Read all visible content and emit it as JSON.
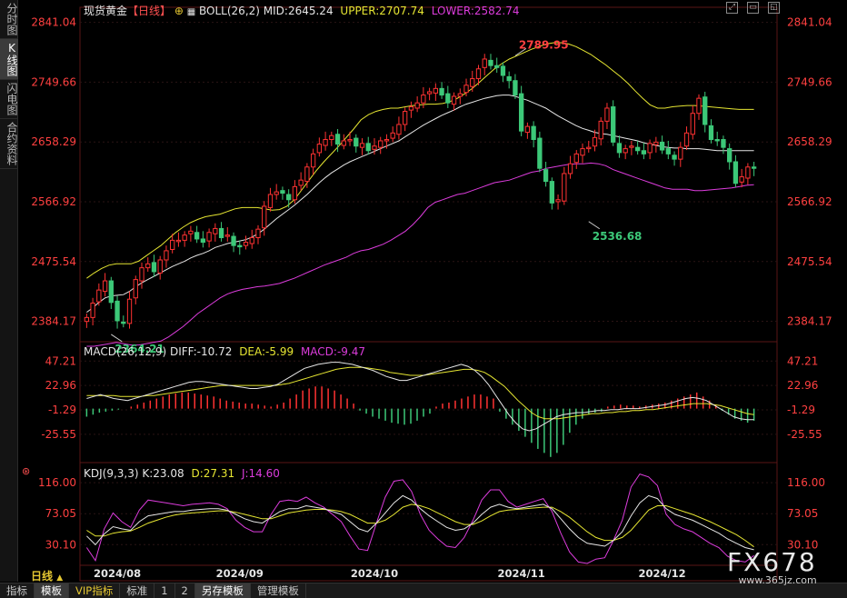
{
  "side_tabs": [
    {
      "label": "分时图",
      "active": false
    },
    {
      "label": "K线图",
      "active": true
    },
    {
      "label": "闪电图",
      "active": false
    },
    {
      "label": "合约资料",
      "active": false
    }
  ],
  "main_header": {
    "symbol": "现货黄金",
    "period_tag": "【日线】",
    "boll_label": "BOLL(26,2)",
    "mid": "MID:2645.24",
    "upper": "UPPER:2707.74",
    "lower": "LOWER:2582.74"
  },
  "macd_header": {
    "label": "MACD(26,12,9)",
    "diff": "DIFF:-10.72",
    "dea": "DEA:-5.99",
    "macd": "MACD:-9.47"
  },
  "kdj_header": {
    "label": "KDJ(9,3,3)",
    "k": "K:23.08",
    "d": "D:27.31",
    "j": "J:14.60"
  },
  "period_button": "日线",
  "bottom_tabs": [
    {
      "label": "指标",
      "active": false
    },
    {
      "label": "模板",
      "active": true
    },
    {
      "label": "VIP指标",
      "active": false
    },
    {
      "label": "标准",
      "active": false
    },
    {
      "label": "1",
      "active": false
    },
    {
      "label": "2",
      "active": false
    },
    {
      "label": "另存模板",
      "active": true
    },
    {
      "label": "管理模板",
      "active": false
    }
  ],
  "watermark": {
    "brand": "FX678",
    "url": "www.365jz.com"
  },
  "colors": {
    "up": "#ff3232",
    "down": "#3cc878",
    "mid": "#e6e6e6",
    "upper": "#e6e632",
    "lower": "#dc3cdc",
    "price_label": "#ff4040",
    "grid": "#2e1a1a"
  },
  "chart_data": [
    {
      "type": "candlestick",
      "title": "现货黄金 日线",
      "y_ticks": [
        2841.04,
        2749.66,
        2658.29,
        2566.92,
        2475.54,
        2384.17
      ],
      "ylim": [
        2353,
        2853
      ],
      "x_labels": [
        "2024/08",
        "2024/09",
        "2024/10",
        "2024/11",
        "2024/12"
      ],
      "x_label_index": [
        5,
        25,
        47,
        71,
        94
      ],
      "annotations": [
        {
          "text": "2789.95",
          "index": 70,
          "value": 2789.95,
          "color": "#ff4040"
        },
        {
          "text": "2536.68",
          "index": 82,
          "value": 2536.68,
          "color": "#3cc878"
        },
        {
          "text": "2364.21",
          "index": 4,
          "value": 2364.21,
          "color": "#3cc878"
        }
      ],
      "closes": [
        2390,
        2412,
        2432,
        2446,
        2413,
        2385,
        2381,
        2418,
        2448,
        2466,
        2472,
        2460,
        2478,
        2492,
        2508,
        2508,
        2516,
        2522,
        2510,
        2505,
        2520,
        2526,
        2512,
        2516,
        2500,
        2498,
        2505,
        2512,
        2525,
        2560,
        2578,
        2582,
        2580,
        2570,
        2590,
        2600,
        2620,
        2640,
        2655,
        2662,
        2668,
        2655,
        2660,
        2662,
        2652,
        2656,
        2645,
        2652,
        2660,
        2662,
        2672,
        2685,
        2705,
        2712,
        2718,
        2730,
        2735,
        2740,
        2730,
        2718,
        2728,
        2732,
        2745,
        2755,
        2770,
        2785,
        2775,
        2772,
        2760,
        2752,
        2730,
        2675,
        2682,
        2662,
        2618,
        2598,
        2565,
        2570,
        2610,
        2625,
        2640,
        2648,
        2650,
        2665,
        2690,
        2710,
        2658,
        2642,
        2648,
        2652,
        2645,
        2640,
        2656,
        2658,
        2646,
        2640,
        2632,
        2650,
        2672,
        2702,
        2725,
        2685,
        2662,
        2660,
        2650,
        2628,
        2595,
        2605,
        2620,
        2618
      ],
      "mid": [
        2398,
        2405,
        2413,
        2420,
        2423,
        2424,
        2425,
        2430,
        2437,
        2443,
        2448,
        2453,
        2458,
        2463,
        2468,
        2472,
        2476,
        2481,
        2485,
        2488,
        2492,
        2497,
        2500,
        2503,
        2505,
        2507,
        2509,
        2513,
        2518,
        2525,
        2533,
        2541,
        2548,
        2555,
        2562,
        2570,
        2578,
        2587,
        2596,
        2604,
        2611,
        2617,
        2623,
        2628,
        2632,
        2636,
        2640,
        2644,
        2648,
        2652,
        2656,
        2660,
        2666,
        2672,
        2678,
        2684,
        2689,
        2694,
        2699,
        2703,
        2707,
        2712,
        2716,
        2719,
        2722,
        2725,
        2727,
        2729,
        2730,
        2730,
        2728,
        2725,
        2722,
        2718,
        2714,
        2710,
        2704,
        2698,
        2693,
        2688,
        2683,
        2679,
        2676,
        2673,
        2671,
        2670,
        2668,
        2666,
        2664,
        2662,
        2660,
        2657,
        2655,
        2653,
        2651,
        2650,
        2649,
        2649,
        2648,
        2648,
        2648,
        2647,
        2646,
        2645,
        2645,
        2645,
        2645,
        2645,
        2645,
        2645
      ],
      "upper": [
        2450,
        2458,
        2465,
        2470,
        2472,
        2472,
        2472,
        2476,
        2484,
        2492,
        2500,
        2510,
        2520,
        2528,
        2535,
        2540,
        2544,
        2546,
        2548,
        2552,
        2556,
        2558,
        2558,
        2558,
        2556,
        2554,
        2555,
        2560,
        2570,
        2585,
        2600,
        2615,
        2628,
        2640,
        2652,
        2665,
        2678,
        2692,
        2700,
        2705,
        2708,
        2710,
        2710,
        2712,
        2714,
        2715,
        2716,
        2716,
        2717,
        2720,
        2725,
        2732,
        2740,
        2750,
        2760,
        2770,
        2778,
        2785,
        2790,
        2795,
        2800,
        2804,
        2808,
        2810,
        2810,
        2808,
        2804,
        2798,
        2792,
        2784,
        2776,
        2767,
        2758,
        2748,
        2736,
        2725,
        2715,
        2710,
        2710,
        2712,
        2713,
        2714,
        2714,
        2713,
        2712,
        2711,
        2710,
        2709,
        2708,
        2708,
        2708
      ],
      "lower": [
        2346,
        2346,
        2348,
        2350,
        2352,
        2350,
        2348,
        2348,
        2350,
        2352,
        2354,
        2360,
        2368,
        2376,
        2386,
        2396,
        2404,
        2412,
        2420,
        2426,
        2430,
        2433,
        2435,
        2437,
        2438,
        2440,
        2442,
        2446,
        2450,
        2455,
        2460,
        2465,
        2470,
        2474,
        2478,
        2482,
        2488,
        2492,
        2494,
        2498,
        2502,
        2508,
        2515,
        2522,
        2532,
        2544,
        2558,
        2566,
        2570,
        2574,
        2578,
        2580,
        2584,
        2588,
        2592,
        2596,
        2598,
        2600,
        2604,
        2608,
        2612,
        2614,
        2618,
        2620,
        2622,
        2624,
        2625,
        2625,
        2626,
        2625,
        2622,
        2616,
        2612,
        2608,
        2604,
        2600,
        2596,
        2592,
        2588,
        2586,
        2586,
        2586,
        2584,
        2584,
        2585,
        2586,
        2587,
        2588,
        2590,
        2592,
        2593
      ]
    },
    {
      "type": "bar",
      "title": "MACD(26,12,9)",
      "y_ticks": [
        47.21,
        22.96,
        -1.29,
        -25.55
      ],
      "ylim": [
        -50,
        52
      ],
      "histogram": [
        -8,
        -6,
        -4,
        -3,
        -2,
        -1,
        0,
        2,
        4,
        6,
        8,
        10,
        12,
        14,
        15,
        16,
        16,
        15,
        14,
        13,
        12,
        10,
        8,
        7,
        6,
        5,
        5,
        4,
        3,
        2,
        4,
        6,
        10,
        14,
        18,
        20,
        22,
        22,
        20,
        18,
        14,
        10,
        5,
        -2,
        -5,
        -8,
        -10,
        -12,
        -14,
        -15,
        -16,
        -15,
        -12,
        -8,
        -5,
        2,
        5,
        6,
        8,
        10,
        12,
        14,
        14,
        12,
        10,
        -3,
        -10,
        -16,
        -22,
        -28,
        -34,
        -40,
        -44,
        -48,
        -44,
        -36,
        -24,
        -16,
        -10,
        -6,
        -4,
        -3,
        2,
        3,
        4,
        3,
        3,
        2,
        3,
        4,
        5,
        6,
        8,
        10,
        12,
        14,
        16,
        12,
        8,
        4,
        -2,
        -6,
        -10,
        -12,
        -14,
        -12
      ],
      "diff": [
        10,
        12,
        14,
        12,
        10,
        9,
        8,
        10,
        12,
        14,
        16,
        18,
        20,
        22,
        24,
        26,
        27,
        27,
        26,
        25,
        24,
        23,
        22,
        21,
        20,
        20,
        21,
        22,
        24,
        28,
        32,
        36,
        40,
        42,
        44,
        45,
        46,
        46,
        45,
        44,
        42,
        40,
        38,
        35,
        32,
        30,
        28,
        28,
        30,
        32,
        34,
        36,
        38,
        40,
        42,
        44,
        42,
        38,
        32,
        24,
        14,
        4,
        -6,
        -14,
        -20,
        -22,
        -20,
        -16,
        -12,
        -8,
        -6,
        -5,
        -4,
        -4,
        -3,
        -2,
        -2,
        -1,
        -1,
        0,
        0,
        0,
        1,
        2,
        3,
        4,
        6,
        8,
        10,
        11,
        10,
        8,
        4,
        0,
        -4,
        -8,
        -10,
        -11,
        -11
      ],
      "dea": [
        13,
        13,
        13,
        13,
        13,
        12,
        12,
        12,
        12,
        13,
        13,
        14,
        15,
        16,
        17,
        18,
        19,
        20,
        21,
        22,
        23,
        23,
        23,
        23,
        23,
        23,
        23,
        23,
        23,
        24,
        25,
        27,
        29,
        31,
        33,
        35,
        37,
        39,
        40,
        41,
        41,
        41,
        40,
        39,
        38,
        36,
        35,
        34,
        33,
        33,
        33,
        34,
        35,
        36,
        37,
        38,
        39,
        39,
        38,
        36,
        32,
        27,
        22,
        15,
        8,
        2,
        -4,
        -8,
        -10,
        -10,
        -10,
        -9,
        -8,
        -7,
        -6,
        -5,
        -5,
        -4,
        -4,
        -3,
        -3,
        -2,
        -2,
        -1,
        -1,
        0,
        1,
        2,
        3,
        4,
        5,
        5,
        5,
        4,
        3,
        1,
        -1,
        -3,
        -5,
        -6
      ]
    },
    {
      "type": "line",
      "title": "KDJ(9,3,3)",
      "y_ticks": [
        116.0,
        73.05,
        30.1
      ],
      "ylim": [
        4,
        130
      ],
      "k": [
        42,
        30,
        45,
        55,
        52,
        50,
        62,
        70,
        72,
        74,
        76,
        76,
        78,
        79,
        80,
        80,
        78,
        72,
        66,
        62,
        60,
        68,
        76,
        80,
        80,
        84,
        82,
        80,
        76,
        72,
        62,
        52,
        48,
        60,
        74,
        88,
        98,
        92,
        80,
        70,
        62,
        54,
        50,
        52,
        60,
        72,
        82,
        86,
        82,
        80,
        82,
        84,
        86,
        80,
        66,
        52,
        40,
        32,
        30,
        28,
        36,
        48,
        70,
        88,
        98,
        94,
        80,
        72,
        68,
        64,
        58,
        52,
        46,
        38,
        32,
        26,
        23
      ],
      "d": [
        50,
        42,
        42,
        46,
        48,
        49,
        54,
        60,
        64,
        68,
        71,
        73,
        74,
        75,
        76,
        77,
        77,
        75,
        72,
        69,
        66,
        66,
        70,
        74,
        76,
        78,
        79,
        79,
        78,
        76,
        72,
        66,
        60,
        60,
        64,
        72,
        82,
        86,
        84,
        80,
        74,
        68,
        62,
        58,
        58,
        63,
        70,
        76,
        78,
        79,
        80,
        81,
        82,
        82,
        76,
        68,
        58,
        48,
        40,
        36,
        36,
        40,
        50,
        64,
        78,
        84,
        84,
        80,
        76,
        72,
        67,
        62,
        56,
        50,
        44,
        36,
        27
      ],
      "j": [
        26,
        8,
        52,
        74,
        62,
        54,
        78,
        92,
        90,
        88,
        86,
        84,
        86,
        87,
        88,
        86,
        80,
        64,
        54,
        48,
        48,
        72,
        90,
        92,
        90,
        96,
        88,
        82,
        72,
        62,
        42,
        24,
        22,
        60,
        96,
        118,
        120,
        104,
        72,
        50,
        38,
        28,
        26,
        40,
        64,
        92,
        106,
        106,
        90,
        82,
        86,
        90,
        94,
        76,
        46,
        20,
        6,
        4,
        10,
        12,
        36,
        64,
        110,
        128,
        124,
        112,
        72,
        58,
        52,
        48,
        40,
        32,
        26,
        14,
        8,
        6,
        15
      ]
    }
  ]
}
